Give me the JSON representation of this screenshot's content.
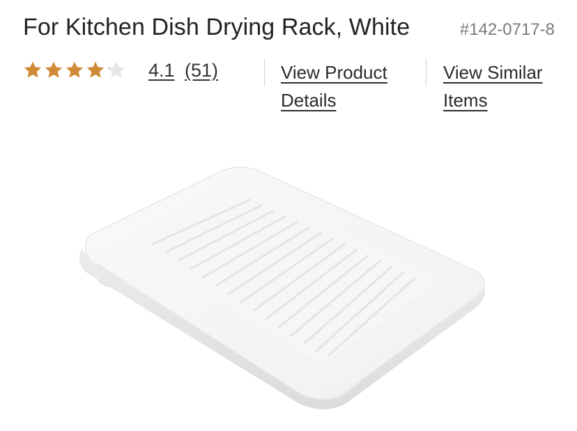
{
  "product": {
    "title": "For Kitchen Dish Drying Rack, White",
    "sku": "#142-0717-8",
    "color": "White"
  },
  "rating": {
    "value": "4.1",
    "count": "(51)",
    "stars_filled_fraction": 0.82,
    "star_color": "#d08a35",
    "star_empty_color": "#e6e6e6"
  },
  "links": {
    "product_details_line1": "View Product",
    "product_details_line2": "Details",
    "similar_items_line1": "View Similar",
    "similar_items_line2": "Items"
  },
  "image": {
    "icon": "dish-drying-mat-image"
  }
}
